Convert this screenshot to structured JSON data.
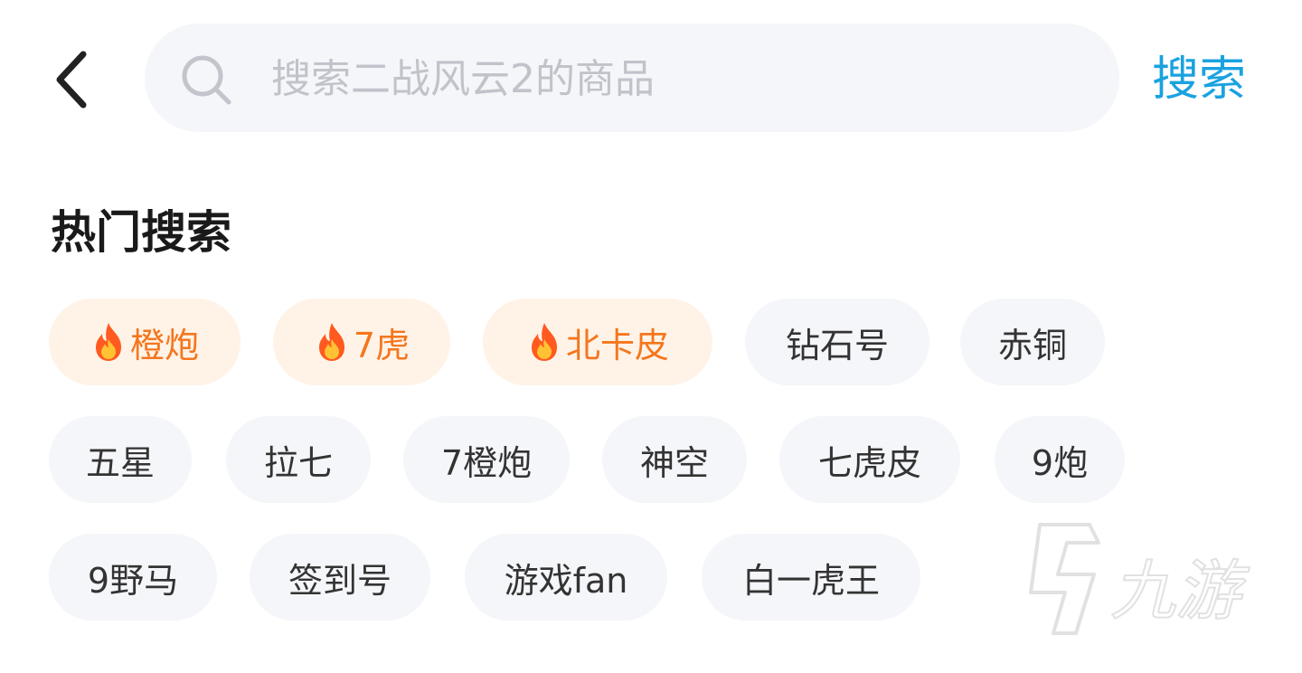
{
  "header": {
    "search_placeholder": "搜索二战风云2的商品",
    "search_button_label": "搜索"
  },
  "hot_search": {
    "title": "热门搜索",
    "tags": [
      {
        "label": "橙炮",
        "hot": true
      },
      {
        "label": "7虎",
        "hot": true
      },
      {
        "label": "北卡皮",
        "hot": true
      },
      {
        "label": "钻石号",
        "hot": false
      },
      {
        "label": "赤铜",
        "hot": false
      },
      {
        "label": "五星",
        "hot": false
      },
      {
        "label": "拉七",
        "hot": false
      },
      {
        "label": "7橙炮",
        "hot": false
      },
      {
        "label": "神空",
        "hot": false
      },
      {
        "label": "七虎皮",
        "hot": false
      },
      {
        "label": "9炮",
        "hot": false
      },
      {
        "label": "9野马",
        "hot": false
      },
      {
        "label": "签到号",
        "hot": false
      },
      {
        "label": "游戏fan",
        "hot": false
      },
      {
        "label": "白一虎王",
        "hot": false
      }
    ]
  },
  "watermark": {
    "text": "九游",
    "icon": "jiuyou-logo-icon"
  },
  "colors": {
    "accent": "#1aa2e0",
    "hot_text": "#f5761d",
    "hot_bg": "#fff3e8",
    "tag_bg": "#f5f6f9",
    "placeholder": "#c1c3cb"
  }
}
